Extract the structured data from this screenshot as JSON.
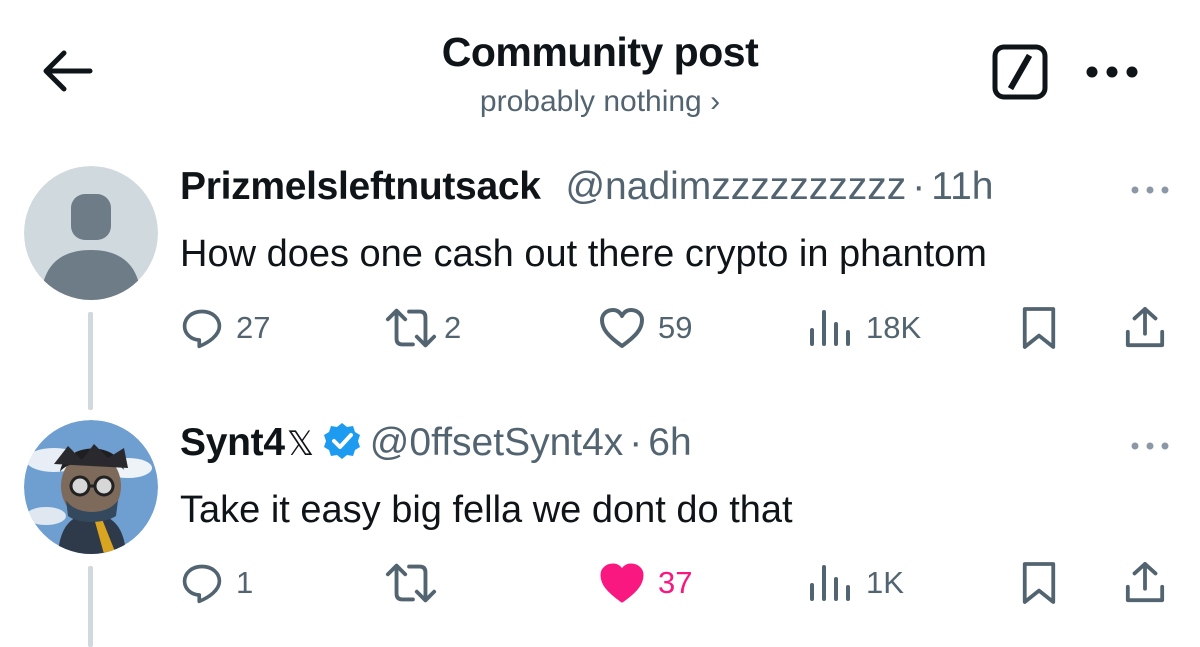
{
  "header": {
    "title": "Community post",
    "community": "probably nothing ›",
    "icons": {
      "back": "arrow-left-icon",
      "compose": "compose-icon",
      "more": "more-horizontal-icon"
    }
  },
  "posts": [
    {
      "name": "Prizmelsleftnutsack",
      "handle": "@nadimzzzzzzzzzz",
      "dot": "·",
      "time": "11h",
      "text": "How does one cash out there crypto in phantom",
      "verified": false,
      "counts": {
        "replies": "27",
        "reposts": "2",
        "likes": "59",
        "views": "18K"
      },
      "liked": false
    },
    {
      "name": "Synt4",
      "name_suffix": "𝕏",
      "handle": "@0ffsetSynt4x",
      "dot": "·",
      "time": "6h",
      "text": "Take it easy big fella we dont do that",
      "verified": true,
      "counts": {
        "replies": "1",
        "reposts": "",
        "likes": "37",
        "views": "1K"
      },
      "liked": true
    }
  ],
  "colors": {
    "text": "#0f1419",
    "secondary": "#536471",
    "like": "#f91880",
    "verified": "#1d9bf0",
    "thread_line": "#cfd9de"
  }
}
